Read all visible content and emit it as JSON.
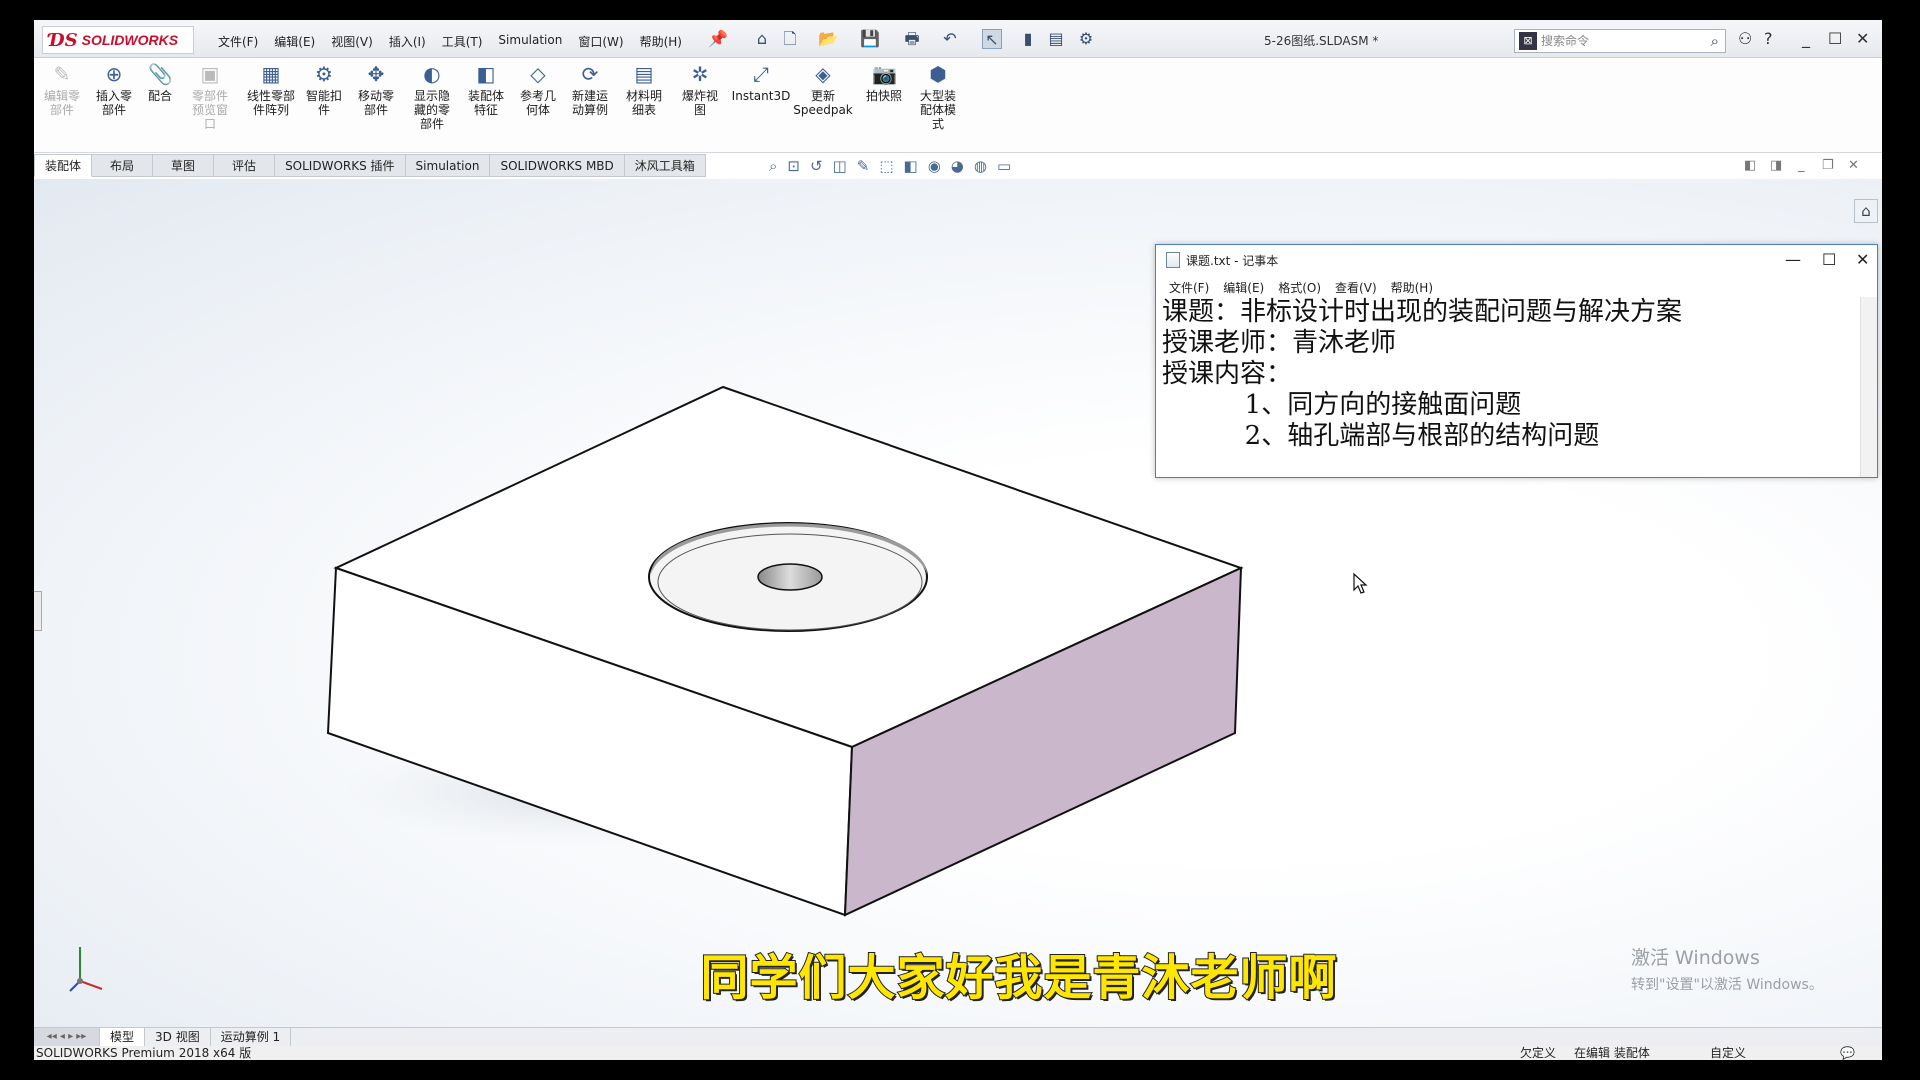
{
  "app": {
    "brand": "SOLIDWORKS",
    "document_title": "5-26图纸.SLDASM *",
    "search_placeholder": "搜索命令"
  },
  "menu": [
    "文件(F)",
    "编辑(E)",
    "视图(V)",
    "插入(I)",
    "工具(T)",
    "Simulation",
    "窗口(W)",
    "帮助(H)"
  ],
  "ribbon": [
    {
      "label": "编辑零\n部件",
      "icon": "edit-component-icon",
      "disabled": true
    },
    {
      "label": "插入零\n部件",
      "icon": "insert-component-icon",
      "disabled": false
    },
    {
      "label": "配合",
      "icon": "mate-icon",
      "disabled": false
    },
    {
      "label": "零部件\n预览窗\n口",
      "icon": "preview-window-icon",
      "disabled": true
    },
    {
      "label": "线性零部\n件阵列",
      "icon": "linear-pattern-icon",
      "disabled": false
    },
    {
      "label": "智能扣\n件",
      "icon": "smart-fastener-icon",
      "disabled": false
    },
    {
      "label": "移动零\n部件",
      "icon": "move-component-icon",
      "disabled": false
    },
    {
      "label": "显示隐\n藏的零\n部件",
      "icon": "show-hidden-icon",
      "disabled": false
    },
    {
      "label": "装配体\n特征",
      "icon": "assembly-feature-icon",
      "disabled": false
    },
    {
      "label": "参考几\n何体",
      "icon": "reference-geometry-icon",
      "disabled": false
    },
    {
      "label": "新建运\n动算例",
      "icon": "motion-study-icon",
      "disabled": false
    },
    {
      "label": "材料明\n细表",
      "icon": "bom-icon",
      "disabled": false
    },
    {
      "label": "爆炸视\n图",
      "icon": "exploded-view-icon",
      "disabled": false
    },
    {
      "label": "Instant3D",
      "icon": "instant3d-icon",
      "disabled": false
    },
    {
      "label": "更新\nSpeedpak",
      "icon": "speedpak-icon",
      "disabled": false
    },
    {
      "label": "拍快照",
      "icon": "snapshot-icon",
      "disabled": false
    },
    {
      "label": "大型装\n配体模\n式",
      "icon": "large-assembly-icon",
      "disabled": false
    }
  ],
  "tabs": [
    "装配体",
    "布局",
    "草图",
    "评估",
    "SOLIDWORKS 插件",
    "Simulation",
    "SOLIDWORKS MBD",
    "沐风工具箱"
  ],
  "notepad": {
    "title": "课题.txt - 记事本",
    "menu": [
      "文件(F)",
      "编辑(E)",
      "格式(O)",
      "查看(V)",
      "帮助(H)"
    ],
    "lines": [
      "课题：非标设计时出现的装配问题与解决方案",
      "授课老师：青沐老师",
      "授课内容：",
      "          1、同方向的接触面问题",
      "          2、轴孔端部与根部的结构问题"
    ]
  },
  "subtitle": "同学们大家好我是青沐老师啊",
  "watermark": {
    "line1": "激活 Windows",
    "line2": "转到\"设置\"以激活 Windows。"
  },
  "bottom_tabs": [
    "模型",
    "3D 视图",
    "运动算例 1"
  ],
  "status": {
    "version": "SOLIDWORKS Premium 2018 x64 版",
    "items": [
      "欠定义",
      "在编辑 装配体",
      "自定义"
    ]
  },
  "colors": {
    "brand_red": "#c8102e",
    "model_side": "#cbb7cb",
    "subtitle_yellow": "#ffe600"
  }
}
